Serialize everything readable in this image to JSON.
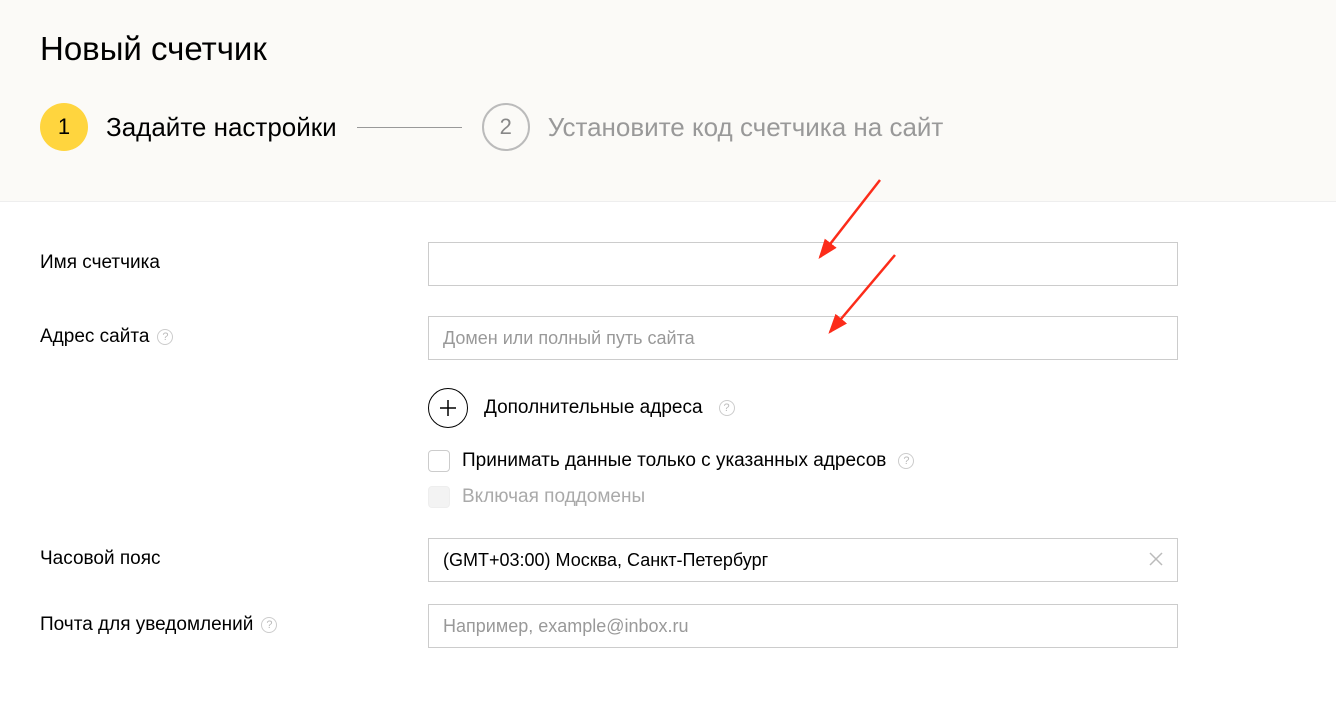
{
  "header": {
    "title": "Новый счетчик",
    "step1_num": "1",
    "step1_label": "Задайте настройки",
    "step2_num": "2",
    "step2_label": "Установите код счетчика на сайт"
  },
  "form": {
    "counter_name_label": "Имя счетчика",
    "site_address_label": "Адрес сайта",
    "site_address_placeholder": "Домен или полный путь сайта",
    "additional_addresses_label": "Дополнительные адреса",
    "accept_only_label": "Принимать данные только с указанных адресов",
    "include_subdomains_label": "Включая поддомены",
    "timezone_label": "Часовой пояс",
    "timezone_value": "(GMT+03:00) Москва, Санкт-Петербург",
    "email_label": "Почта для уведомлений",
    "email_placeholder": "Например, example@inbox.ru"
  }
}
